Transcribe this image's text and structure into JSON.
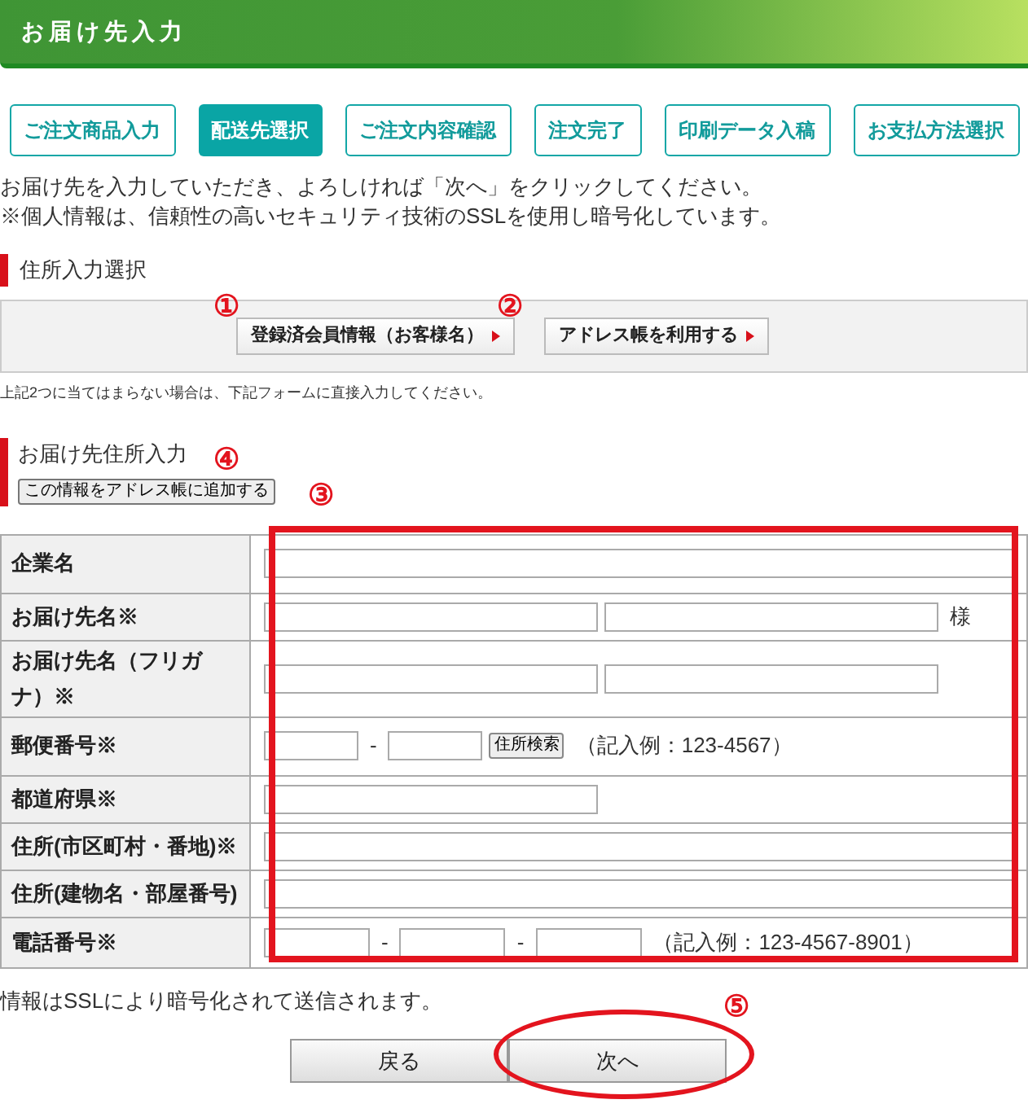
{
  "header": {
    "title": "お届け先入力"
  },
  "steps": [
    {
      "label": "ご注文商品入力",
      "selected": false
    },
    {
      "label": "配送先選択",
      "selected": true
    },
    {
      "label": "ご注文内容確認",
      "selected": false
    },
    {
      "label": "注文完了",
      "selected": false
    },
    {
      "label": "印刷データ入稿",
      "selected": false
    },
    {
      "label": "お支払方法選択",
      "selected": false
    }
  ],
  "intro": [
    "お届け先を入力していただき、よろしければ「次へ」をクリックしてください。",
    "※個人情報は、信頼性の高いセキュリティ技術のSSLを使用し暗号化しています。"
  ],
  "address_select": {
    "heading": "住所入力選択",
    "buttons": [
      "登録済会員情報（お客様名）",
      "アドレス帳を利用する"
    ],
    "note": "上記2つに当てはまらない場合は、下記フォームに直接入力してください。"
  },
  "address_input": {
    "heading": "お届け先住所入力",
    "add_button": "この情報をアドレス帳に追加する"
  },
  "form_rows": [
    {
      "label": "企業名",
      "items": [
        {
          "kind": "wide"
        }
      ]
    },
    {
      "label": "お届け先名※",
      "items": [
        {
          "kind": "half"
        },
        {
          "kind": "half"
        },
        {
          "kind": "text",
          "text": "様"
        }
      ]
    },
    {
      "label": "お届け先名（フリガナ）※",
      "items": [
        {
          "kind": "half"
        },
        {
          "kind": "half"
        }
      ]
    },
    {
      "label": "郵便番号※",
      "items": [
        {
          "kind": "short"
        },
        {
          "kind": "text",
          "text": "-"
        },
        {
          "kind": "short"
        },
        {
          "kind": "button",
          "text": "住所検索"
        },
        {
          "kind": "text",
          "text": "（記入例：123-4567）"
        }
      ]
    },
    {
      "label": "都道府県※",
      "items": [
        {
          "kind": "half"
        }
      ]
    },
    {
      "label": "住所(市区町村・番地)※",
      "items": [
        {
          "kind": "wide"
        }
      ]
    },
    {
      "label": "住所(建物名・部屋番号)",
      "items": [
        {
          "kind": "wide"
        }
      ]
    },
    {
      "label": "電話番号※",
      "items": [
        {
          "kind": "phone"
        },
        {
          "kind": "text",
          "text": "-"
        },
        {
          "kind": "phone"
        },
        {
          "kind": "text",
          "text": "-"
        },
        {
          "kind": "phone"
        },
        {
          "kind": "text",
          "text": "（記入例：123-4567-8901）"
        }
      ]
    }
  ],
  "footer_note": "情報はSSLにより暗号化されて送信されます。",
  "nav_buttons": [
    "戻る",
    "次へ"
  ],
  "annotations": [
    "①",
    "②",
    "④",
    "③",
    "⑤"
  ]
}
